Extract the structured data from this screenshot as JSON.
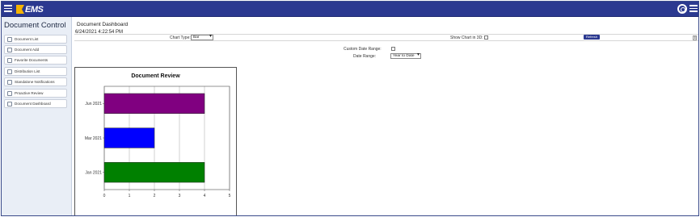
{
  "app": {
    "logo_text": "EMS",
    "brand_color": "#2b3990"
  },
  "topbar": {
    "left_menu_icon": "hamburger-icon",
    "settings_icon": "gear-icon",
    "right_menu_icon": "hamburger-icon"
  },
  "sidebar": {
    "title": "Document Control",
    "items": [
      {
        "label": "Document List",
        "icon": "list-icon"
      },
      {
        "label": "Document Add",
        "icon": "add-icon"
      },
      {
        "label": "Favorite Documents",
        "icon": "star-icon"
      },
      {
        "label": "Distribution List",
        "icon": "table-icon"
      },
      {
        "label": "Standalone Notifications",
        "icon": "notification-icon"
      },
      {
        "label": "Proactive Review",
        "icon": "review-icon"
      },
      {
        "label": "Document Dashboard",
        "icon": "dashboard-icon"
      }
    ]
  },
  "main": {
    "title": "Document Dashboard",
    "timestamp": "6/24/2021 4:22:54 PM",
    "chart_type_label": "Chart Type:",
    "chart_type_value": "Bar",
    "show_3d_label": "Show Chart in 3D:",
    "refresh_label": "Refresh",
    "custom_date_label": "Custom Date Range:",
    "date_range_label": "Date Range:",
    "date_range_value": "Year to Date"
  },
  "chart_data": {
    "type": "bar",
    "orientation": "horizontal",
    "title": "Document Review",
    "categories": [
      "Jan 2021",
      "Mar 2021",
      "Jun 2021"
    ],
    "values": [
      4,
      2,
      4
    ],
    "colors": [
      "#008000",
      "#0000ff",
      "#800080"
    ],
    "xlim": [
      0,
      5
    ],
    "xticks": [
      "0",
      "1",
      "2",
      "3",
      "4",
      "5"
    ],
    "grid": true,
    "legend": "none"
  }
}
